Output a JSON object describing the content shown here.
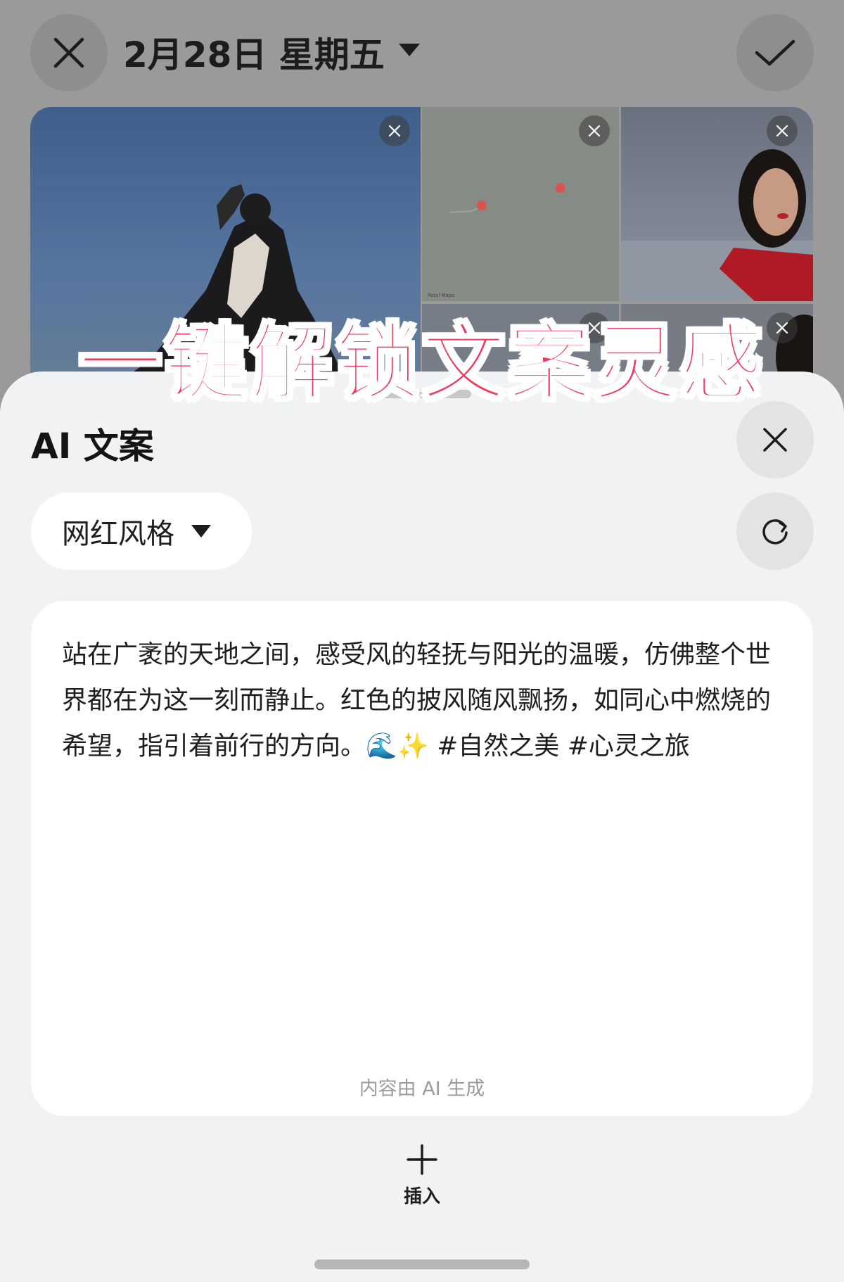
{
  "header": {
    "date": "2月28日 星期五",
    "close_icon": "close-icon",
    "confirm_icon": "check-icon",
    "caret_icon": "caret-down-icon"
  },
  "photos": [
    {
      "name": "photo-man-in-black-coat-sky"
    },
    {
      "name": "photo-map-with-pins",
      "map_credit": "Petal Maps"
    },
    {
      "name": "photo-woman-red-lips-sea"
    },
    {
      "name": "photo-small-thumbnail"
    },
    {
      "name": "photo-partial-portrait"
    }
  ],
  "promo_text": "一键解锁文案灵感",
  "sheet": {
    "title": "AI 文案",
    "style_option": "网红风格",
    "generated_text": "站在广袤的天地之间，感受风的轻抚与阳光的温暖，仿佛整个世界都在为这一刻而静止。红色的披风随风飘扬，如同心中燃烧的希望，指引着前行的方向。🌊✨ #自然之美 #心灵之旅",
    "ai_note": "内容由 AI 生成",
    "insert_label": "插入"
  },
  "colors": {
    "promo": "#f0395f",
    "sheet_bg": "#f1f2f4",
    "card_bg": "#ffffff",
    "dim_bg": "#9a9a9a"
  }
}
